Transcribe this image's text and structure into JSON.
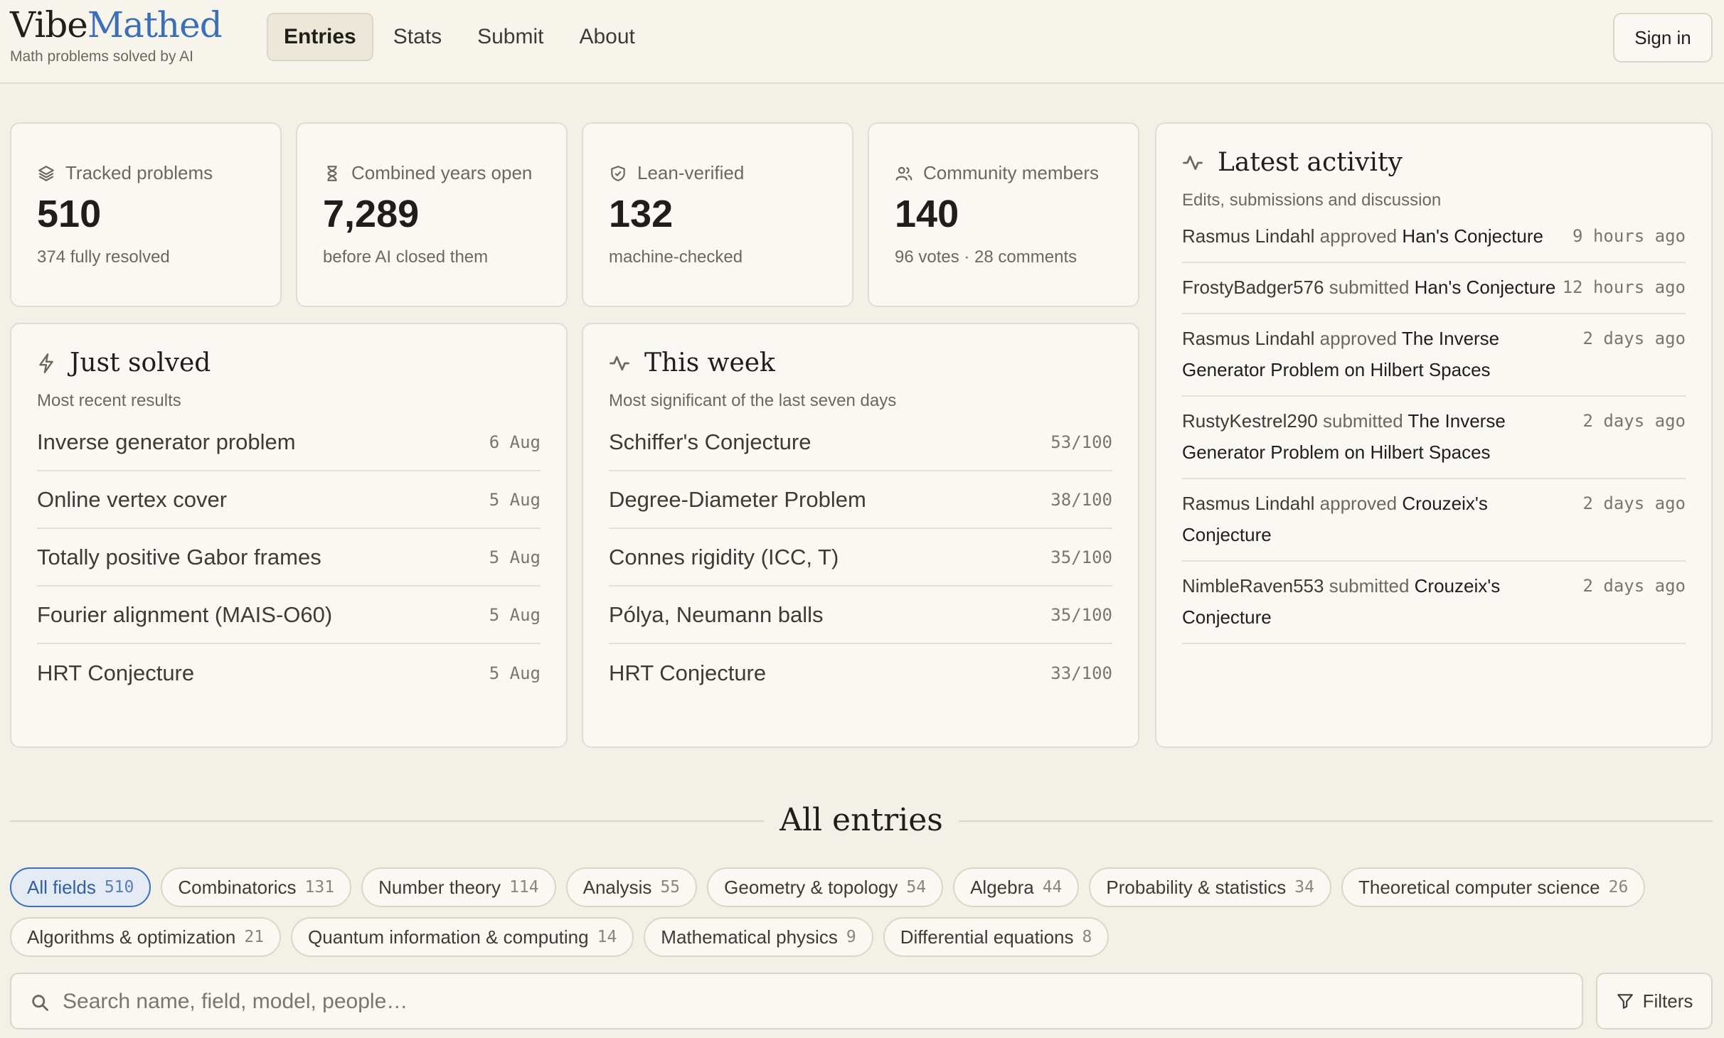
{
  "header": {
    "logo_part1": "Vibe",
    "logo_part2": "Mathed",
    "tagline": "Math problems solved by AI",
    "nav": [
      {
        "label": "Entries",
        "active": true
      },
      {
        "label": "Stats"
      },
      {
        "label": "Submit"
      },
      {
        "label": "About"
      }
    ],
    "signin_label": "Sign in"
  },
  "stats": [
    {
      "icon": "layers-icon",
      "label": "Tracked problems",
      "value": "510",
      "sub": "374 fully resolved"
    },
    {
      "icon": "hourglass-icon",
      "label": "Combined years open",
      "value": "7,289",
      "sub": "before AI closed them"
    },
    {
      "icon": "shield-check-icon",
      "label": "Lean-verified",
      "value": "132",
      "sub": "machine-checked"
    },
    {
      "icon": "users-icon",
      "label": "Community members",
      "value": "140",
      "sub": "96 votes · 28 comments"
    }
  ],
  "just_solved": {
    "title": "Just solved",
    "subtitle": "Most recent results",
    "items": [
      {
        "name": "Inverse generator problem",
        "date": "6 Aug"
      },
      {
        "name": "Online vertex cover",
        "date": "5 Aug"
      },
      {
        "name": "Totally positive Gabor frames",
        "date": "5 Aug"
      },
      {
        "name": "Fourier alignment (MAIS-O60)",
        "date": "5 Aug"
      },
      {
        "name": "HRT Conjecture",
        "date": "5 Aug"
      }
    ]
  },
  "this_week": {
    "title": "This week",
    "subtitle": "Most significant of the last seven days",
    "items": [
      {
        "name": "Schiffer's Conjecture",
        "score": "53/100"
      },
      {
        "name": "Degree-Diameter Problem",
        "score": "38/100"
      },
      {
        "name": "Connes rigidity (ICC, T)",
        "score": "35/100"
      },
      {
        "name": "Pólya, Neumann balls",
        "score": "35/100"
      },
      {
        "name": "HRT Conjecture",
        "score": "33/100"
      }
    ]
  },
  "activity": {
    "title": "Latest activity",
    "subtitle": "Edits, submissions and discussion",
    "items": [
      {
        "who": "Rasmus Lindahl",
        "verb": "approved",
        "what": "Han's Conjecture",
        "time": "9 hours ago"
      },
      {
        "who": "FrostyBadger576",
        "verb": "submitted",
        "what": "Han's Conjecture",
        "time": "12 hours ago"
      },
      {
        "who": "Rasmus Lindahl",
        "verb": "approved",
        "what": "The Inverse Generator Problem on Hilbert Spaces",
        "time": "2 days ago"
      },
      {
        "who": "RustyKestrel290",
        "verb": "submitted",
        "what": "The Inverse Generator Problem on Hilbert Spaces",
        "time": "2 days ago"
      },
      {
        "who": "Rasmus Lindahl",
        "verb": "approved",
        "what": "Crouzeix's Conjecture",
        "time": "2 days ago"
      },
      {
        "who": "NimbleRaven553",
        "verb": "submitted",
        "what": "Crouzeix's Conjecture",
        "time": "2 days ago"
      }
    ]
  },
  "all_entries": {
    "title": "All entries",
    "chips": [
      {
        "label": "All fields",
        "count": "510",
        "active": true
      },
      {
        "label": "Combinatorics",
        "count": "131"
      },
      {
        "label": "Number theory",
        "count": "114"
      },
      {
        "label": "Analysis",
        "count": "55"
      },
      {
        "label": "Geometry & topology",
        "count": "54"
      },
      {
        "label": "Algebra",
        "count": "44"
      },
      {
        "label": "Probability & statistics",
        "count": "34"
      },
      {
        "label": "Theoretical computer science",
        "count": "26"
      },
      {
        "label": "Algorithms & optimization",
        "count": "21"
      },
      {
        "label": "Quantum information & computing",
        "count": "14"
      },
      {
        "label": "Mathematical physics",
        "count": "9"
      },
      {
        "label": "Differential equations",
        "count": "8"
      }
    ],
    "search_placeholder": "Search name, field, model, people…",
    "filters_label": "Filters"
  }
}
